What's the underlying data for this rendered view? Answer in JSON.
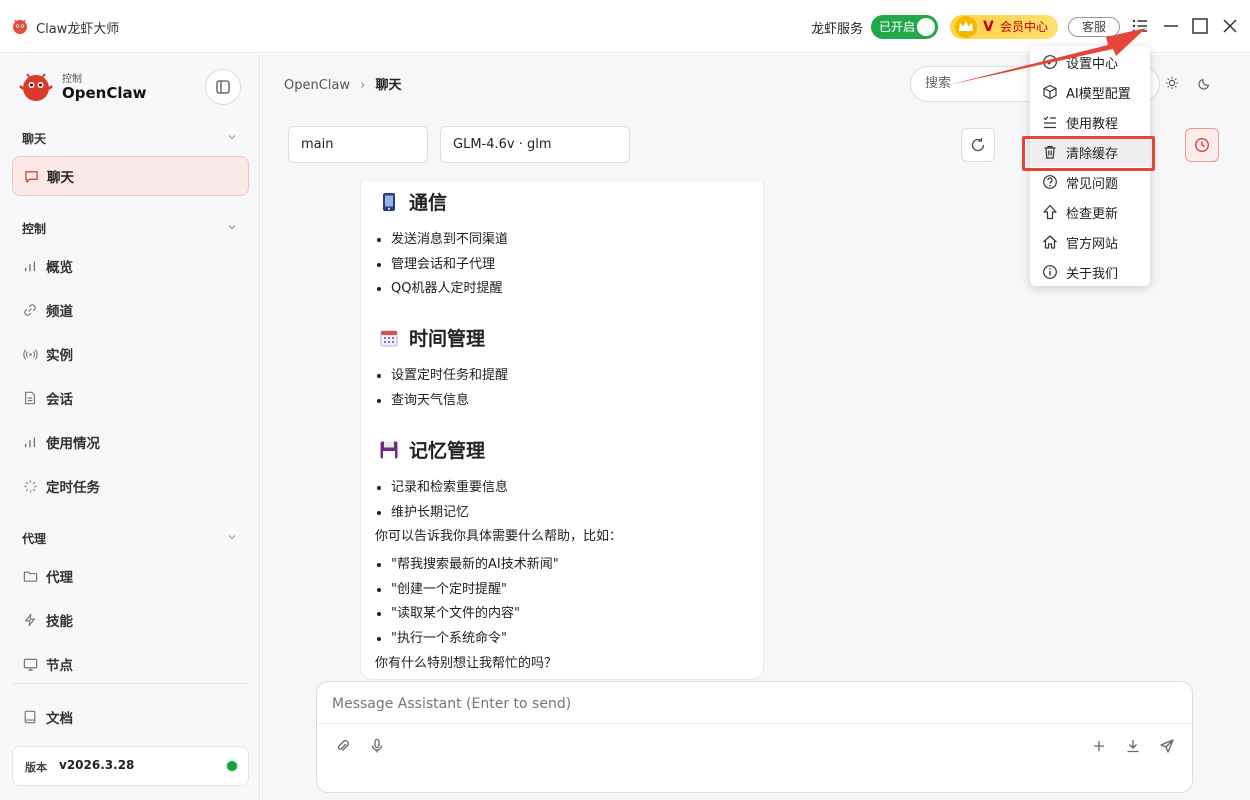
{
  "app": {
    "title": "Claw龙虾大师"
  },
  "titlebar": {
    "service_label": "龙虾服务",
    "service_toggle": "已开启",
    "vip_mark": "V",
    "vip_label": "会员中心",
    "support": "客服"
  },
  "sidebar": {
    "brand_sub": "控制",
    "brand_name": "OpenClaw",
    "sections": [
      {
        "label": "聊天",
        "items": [
          {
            "label": "聊天",
            "icon": "chat-bubble-icon",
            "active": true
          }
        ]
      },
      {
        "label": "控制",
        "items": [
          {
            "label": "概览",
            "icon": "bar-chart-icon"
          },
          {
            "label": "频道",
            "icon": "link-icon"
          },
          {
            "label": "实例",
            "icon": "broadcast-icon"
          },
          {
            "label": "会话",
            "icon": "document-icon"
          },
          {
            "label": "使用情况",
            "icon": "bar-chart-icon"
          },
          {
            "label": "定时任务",
            "icon": "loader-icon"
          }
        ]
      },
      {
        "label": "代理",
        "items": [
          {
            "label": "代理",
            "icon": "folder-icon"
          },
          {
            "label": "技能",
            "icon": "lightning-icon"
          },
          {
            "label": "节点",
            "icon": "monitor-icon"
          }
        ]
      }
    ],
    "docs": "文档",
    "version_label": "版本",
    "version_value": "v2026.3.28"
  },
  "header": {
    "breadcrumb_root": "OpenClaw",
    "breadcrumb_sep": "›",
    "breadcrumb_current": "聊天",
    "search_placeholder": "搜索"
  },
  "toolbar": {
    "session": "main",
    "model": "GLM-4.6v · glm"
  },
  "message": {
    "sections": [
      {
        "emoji": "phone-emoji",
        "title": "通信",
        "items": [
          "发送消息到不同渠道",
          "管理会话和子代理",
          "QQ机器人定时提醒"
        ]
      },
      {
        "emoji": "calendar-emoji",
        "title": "时间管理",
        "items": [
          "设置定时任务和提醒",
          "查询天气信息"
        ]
      },
      {
        "emoji": "floppy-emoji",
        "title": "记忆管理",
        "items": [
          "记录和检索重要信息",
          "维护长期记忆"
        ]
      }
    ],
    "prompt_text": "你可以告诉我你具体需要什么帮助，比如：",
    "examples": [
      "\"帮我搜索最新的AI技术新闻\"",
      "\"创建一个定时提醒\"",
      "\"读取某个文件的内容\"",
      "\"执行一个系统命令\""
    ],
    "closing": "你有什么特别想让我帮忙的吗？"
  },
  "composer": {
    "placeholder": "Message Assistant (Enter to send)"
  },
  "menu": {
    "items": [
      {
        "label": "设置中心",
        "icon": "settings-check-icon"
      },
      {
        "label": "AI模型配置",
        "icon": "cube-icon"
      },
      {
        "label": "使用教程",
        "icon": "checklist-icon"
      },
      {
        "label": "清除缓存",
        "icon": "trash-icon",
        "highlighted": true
      },
      {
        "label": "常见问题",
        "icon": "question-icon"
      },
      {
        "label": "检查更新",
        "icon": "arrow-up-icon"
      },
      {
        "label": "官方网站",
        "icon": "home-icon"
      },
      {
        "label": "关于我们",
        "icon": "info-icon"
      }
    ]
  },
  "colors": {
    "accent_red": "#e5453a",
    "toggle_green": "#22a84a",
    "vip_gold": "#ffd24a"
  }
}
